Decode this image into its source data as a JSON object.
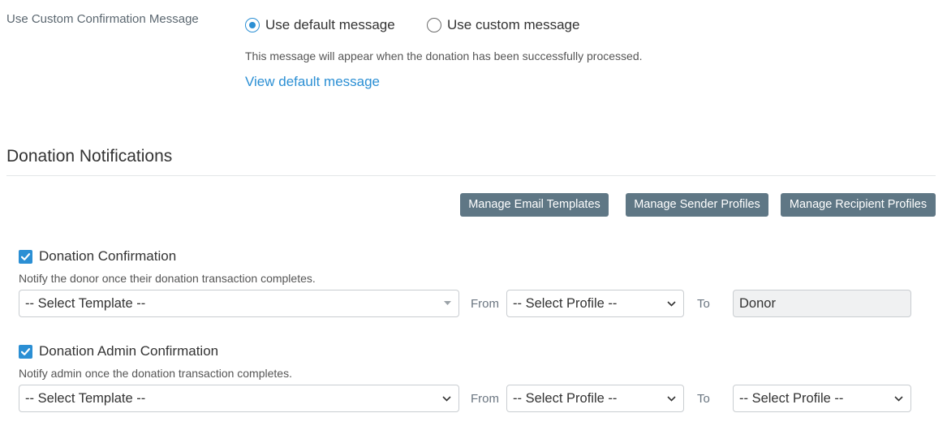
{
  "confirmation": {
    "label": "Use Custom Confirmation Message",
    "option_default": "Use default message",
    "option_custom": "Use custom message",
    "selected": "default",
    "hint": "This message will appear when the donation has been successfully processed.",
    "view_link": "View default message"
  },
  "notifications": {
    "title": "Donation Notifications",
    "buttons": {
      "templates": "Manage Email Templates",
      "senders": "Manage Sender Profiles",
      "recipients": "Manage Recipient Profiles"
    },
    "items": [
      {
        "name": "Donation Confirmation",
        "checked": true,
        "description": "Notify the donor once their donation transaction completes.",
        "template_value": "-- Select Template --",
        "from_label": "From",
        "from_value": "-- Select Profile --",
        "to_label": "To",
        "to_value": "Donor"
      },
      {
        "name": "Donation Admin Confirmation",
        "checked": true,
        "description": "Notify admin once the donation transaction completes.",
        "template_value": "-- Select Template --",
        "from_label": "From",
        "from_value": "-- Select Profile --",
        "to_label": "To",
        "to_value": "-- Select Profile --"
      }
    ]
  },
  "colors": {
    "accent": "#2b8fd4",
    "button_bg": "#5f7785"
  },
  "icons": {
    "radio": "radio-icon",
    "checkbox": "checkbox-check-icon",
    "chevron": "chevron-down-icon",
    "caret": "caret-down-icon"
  }
}
